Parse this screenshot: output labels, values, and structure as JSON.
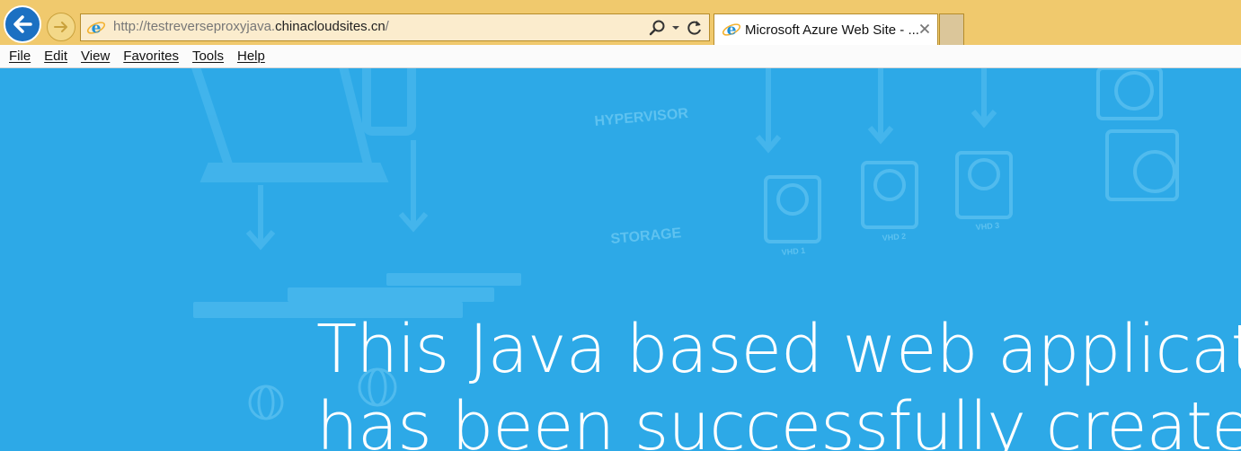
{
  "browser": {
    "address_bar": {
      "url_prefix": "http://testreverseproxyjava.",
      "url_domain": "chinacloudsites.cn",
      "url_suffix": "/"
    },
    "tabs": [
      {
        "title": "Microsoft Azure Web Site - ..."
      }
    ],
    "menu": [
      {
        "label": "File"
      },
      {
        "label": "Edit"
      },
      {
        "label": "View"
      },
      {
        "label": "Favorites"
      },
      {
        "label": "Tools"
      },
      {
        "label": "Help"
      }
    ],
    "colors": {
      "chrome": "#f0c96d",
      "address_bg": "#fbeccd",
      "back_button": "#1b70c2"
    }
  },
  "page": {
    "background_color": "#2da9e7",
    "background_labels": [
      "HYPERVISOR",
      "STORAGE",
      "VHD 1",
      "VHD 2",
      "VHD 3"
    ],
    "headline": {
      "line1": "This Java based web application",
      "line2": "has been successfully created"
    }
  }
}
